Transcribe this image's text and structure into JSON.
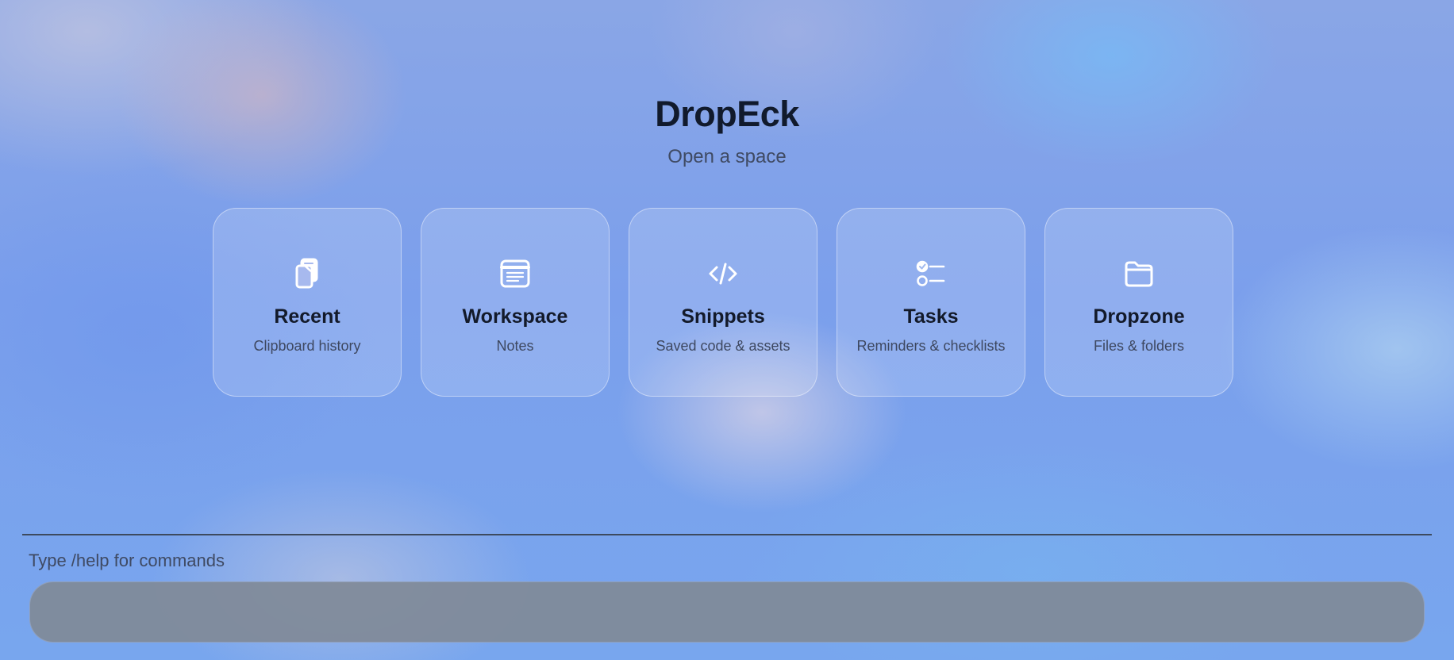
{
  "app": {
    "title": "DropEck",
    "subtitle": "Open a space"
  },
  "spaces": [
    {
      "icon": "clipboard-copy-icon",
      "title": "Recent",
      "subtitle": "Clipboard history"
    },
    {
      "icon": "note-icon",
      "title": "Workspace",
      "subtitle": "Notes"
    },
    {
      "icon": "code-icon",
      "title": "Snippets",
      "subtitle": "Saved code & assets"
    },
    {
      "icon": "checklist-icon",
      "title": "Tasks",
      "subtitle": "Reminders & checklists"
    },
    {
      "icon": "folder-icon",
      "title": "Dropzone",
      "subtitle": "Files & folders"
    }
  ],
  "command": {
    "hint": "Type /help for commands",
    "value": "",
    "placeholder": ""
  },
  "colors": {
    "title_text": "#111a2c",
    "subtitle_text": "#3f4a63",
    "input_background": "#808a98",
    "icon_color": "#ffffff"
  }
}
